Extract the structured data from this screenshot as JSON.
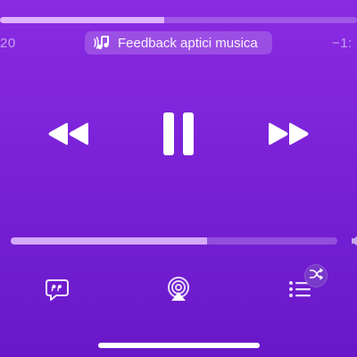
{
  "playback": {
    "progress": 0.46,
    "time_elapsed": "20",
    "time_remaining": "−1:"
  },
  "haptics": {
    "label": "Feedback aptici musica",
    "icon": "haptic-feedback-icon"
  },
  "controls": {
    "rewind_icon": "backward-icon",
    "play_pause_icon": "pause-icon",
    "forward_icon": "forward-icon"
  },
  "volume": {
    "level": 0.6
  },
  "bottom_bar": {
    "lyrics_icon": "lyrics-icon",
    "airplay_icon": "airplay-icon",
    "queue_icon": "queue-icon",
    "shuffle_icon": "shuffle-icon"
  },
  "colors": {
    "background": "#7a22d8",
    "accent": "#e6beff"
  }
}
